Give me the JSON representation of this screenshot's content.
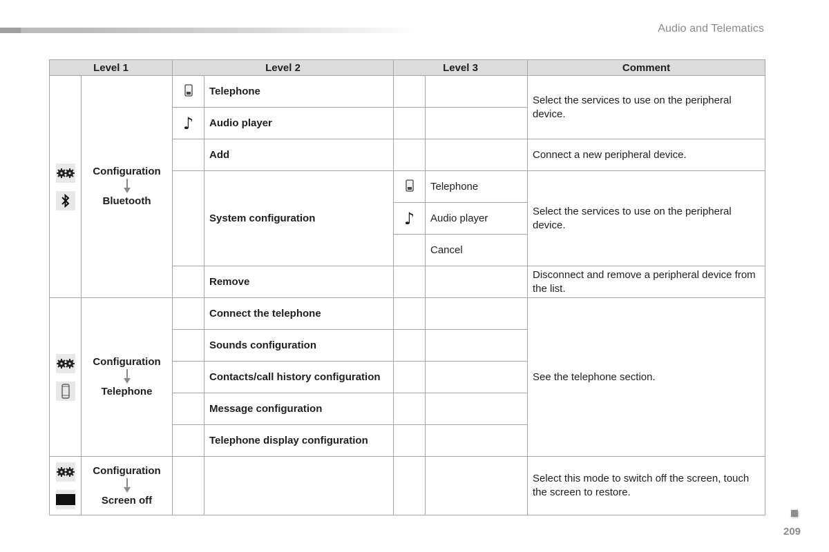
{
  "header": {
    "section_title": "Audio and Telematics"
  },
  "table": {
    "columns": [
      "Level 1",
      "Level 2",
      "Level 3",
      "Comment"
    ],
    "groups": [
      {
        "level1": {
          "label_top": "Configuration",
          "label_bottom": "Bluetooth",
          "icons": [
            "gears-icon",
            "bluetooth-icon"
          ]
        },
        "rows": [
          {
            "level2_icon": "phone-icon",
            "level2": "Telephone",
            "level3_icon": "",
            "level3": ""
          },
          {
            "level2_icon": "music-note-icon",
            "level2": "Audio player",
            "level3_icon": "",
            "level3": ""
          },
          {
            "level2_icon": "",
            "level2": "Add",
            "level3_icon": "",
            "level3": ""
          },
          {
            "level2_icon": "",
            "level2": "System configuration",
            "sub": [
              {
                "level3_icon": "phone-icon",
                "level3": "Telephone"
              },
              {
                "level3_icon": "music-note-icon",
                "level3": "Audio player"
              },
              {
                "level3_icon": "",
                "level3": "Cancel"
              }
            ]
          },
          {
            "level2_icon": "",
            "level2": "Remove",
            "level3_icon": "",
            "level3": ""
          }
        ],
        "comments": [
          "Select the services to use on the peripheral device.",
          "Connect a new peripheral device.",
          "Select the services to use on the peripheral device.",
          "Disconnect and remove a peripheral device from the list."
        ]
      },
      {
        "level1": {
          "label_top": "Configuration",
          "label_bottom": "Telephone",
          "icons": [
            "gears-icon",
            "smartphone-icon"
          ]
        },
        "rows": [
          {
            "level2": "Connect the telephone"
          },
          {
            "level2": "Sounds configuration"
          },
          {
            "level2": "Contacts/call history configuration"
          },
          {
            "level2": "Message configuration"
          },
          {
            "level2": "Telephone display configuration"
          }
        ],
        "comments": [
          "See the telephone section."
        ]
      },
      {
        "level1": {
          "label_top": "Configuration",
          "label_bottom": "Screen off",
          "icons": [
            "gears-icon",
            "black-screen-icon"
          ]
        },
        "rows": [
          {
            "level2": ""
          }
        ],
        "comments": [
          "Select this mode to switch off the screen, touch the screen to restore."
        ]
      }
    ]
  },
  "footer": {
    "page_number": "209"
  },
  "colors": {
    "header_bg": "#dcdcdc",
    "border": "#a6a6a6",
    "muted_text": "#8a8a8a",
    "icon_bg": "#e8e8e8"
  }
}
